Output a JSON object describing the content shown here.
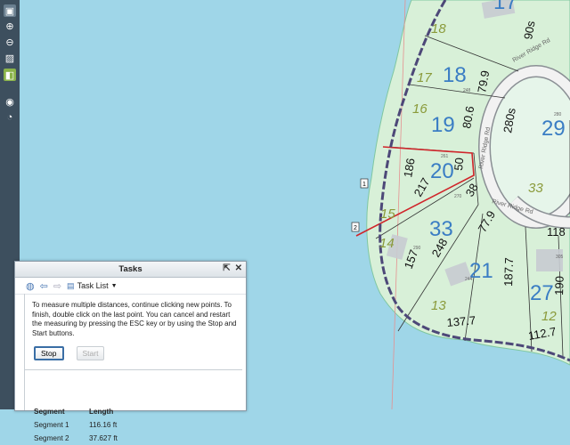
{
  "toolbar": {
    "icons": [
      "select-icon",
      "zoom-in-icon",
      "zoom-out-icon",
      "full-extent-icon",
      "identify-icon",
      "layers-icon",
      "measure-icon"
    ]
  },
  "map": {
    "lots": [
      "17",
      "18",
      "19",
      "20",
      "33",
      "21",
      "27",
      "29"
    ],
    "lot_subs": [
      "18",
      "17",
      "16",
      "15",
      "14",
      "13",
      "12",
      "33"
    ],
    "dims": [
      "90s",
      "79.9",
      "80.6",
      "280s",
      "50",
      "186",
      "217",
      "38",
      "77.9",
      "118",
      "248",
      "157",
      "187.7",
      "190",
      "137.7",
      "112.7"
    ],
    "parcel_ids": [
      "248",
      "261",
      "270",
      "280",
      "290",
      "244",
      "305"
    ],
    "road": "River Ridge Rd",
    "points": [
      "1",
      "2"
    ]
  },
  "tasks": {
    "title": "Tasks",
    "task_list_label": "Task List",
    "instructions": "To measure multiple distances, continue clicking new points. To finish, double click on the last point. You can cancel and restart the measuring by pressing the ESC key or by using the Stop and Start buttons.",
    "stop_label": "Stop",
    "start_label": "Start",
    "table": {
      "headers": [
        "Segment",
        "Length"
      ],
      "rows": [
        [
          "Segment 1",
          "116.16 ft"
        ],
        [
          "Segment 2",
          "37.627 ft"
        ]
      ]
    }
  }
}
